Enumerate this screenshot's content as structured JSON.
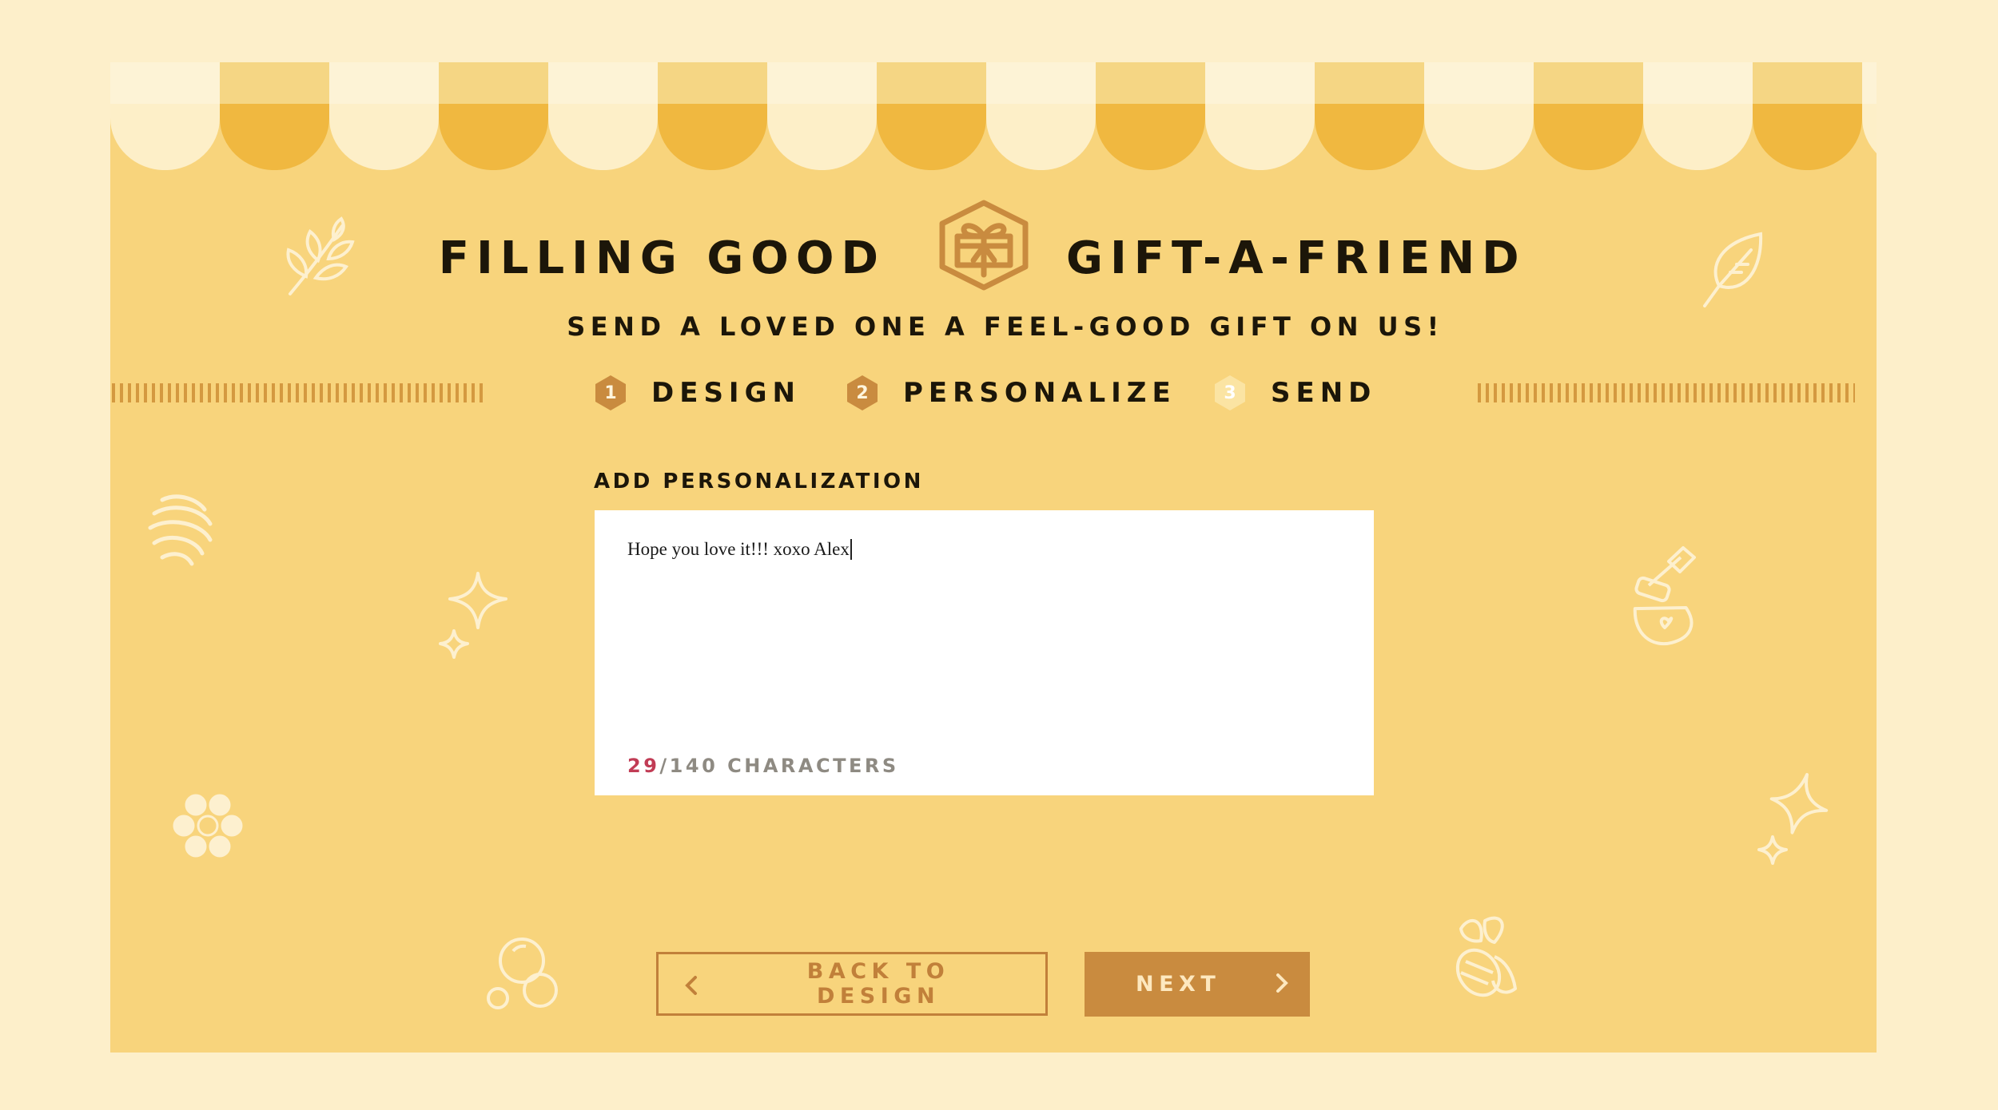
{
  "header": {
    "title_left": "FILLING GOOD",
    "title_right": "GIFT-A-FRIEND",
    "subtitle": "SEND A LOVED ONE A FEEL-GOOD GIFT ON US!",
    "logo_icon": "gift-box-hexagon-icon"
  },
  "steps": [
    {
      "number": "1",
      "label": "DESIGN",
      "state": "completed"
    },
    {
      "number": "2",
      "label": "PERSONALIZE",
      "state": "current"
    },
    {
      "number": "3",
      "label": "SEND",
      "state": "upcoming"
    }
  ],
  "form": {
    "section_label": "ADD PERSONALIZATION",
    "message_value": "Hope you love it!!! xoxo Alex",
    "char_count": "29",
    "char_limit": "/140 CHARACTERS"
  },
  "buttons": {
    "back_label": "BACK TO DESIGN",
    "next_label": "NEXT"
  },
  "colors": {
    "page_background": "#fdefca",
    "panel_background": "#f8d47c",
    "awning_light": "#fdefc8",
    "awning_dark": "#f0b840",
    "accent_brown": "#c98b3f",
    "counter_red": "#c13c55",
    "text_dark": "#1c1609"
  }
}
